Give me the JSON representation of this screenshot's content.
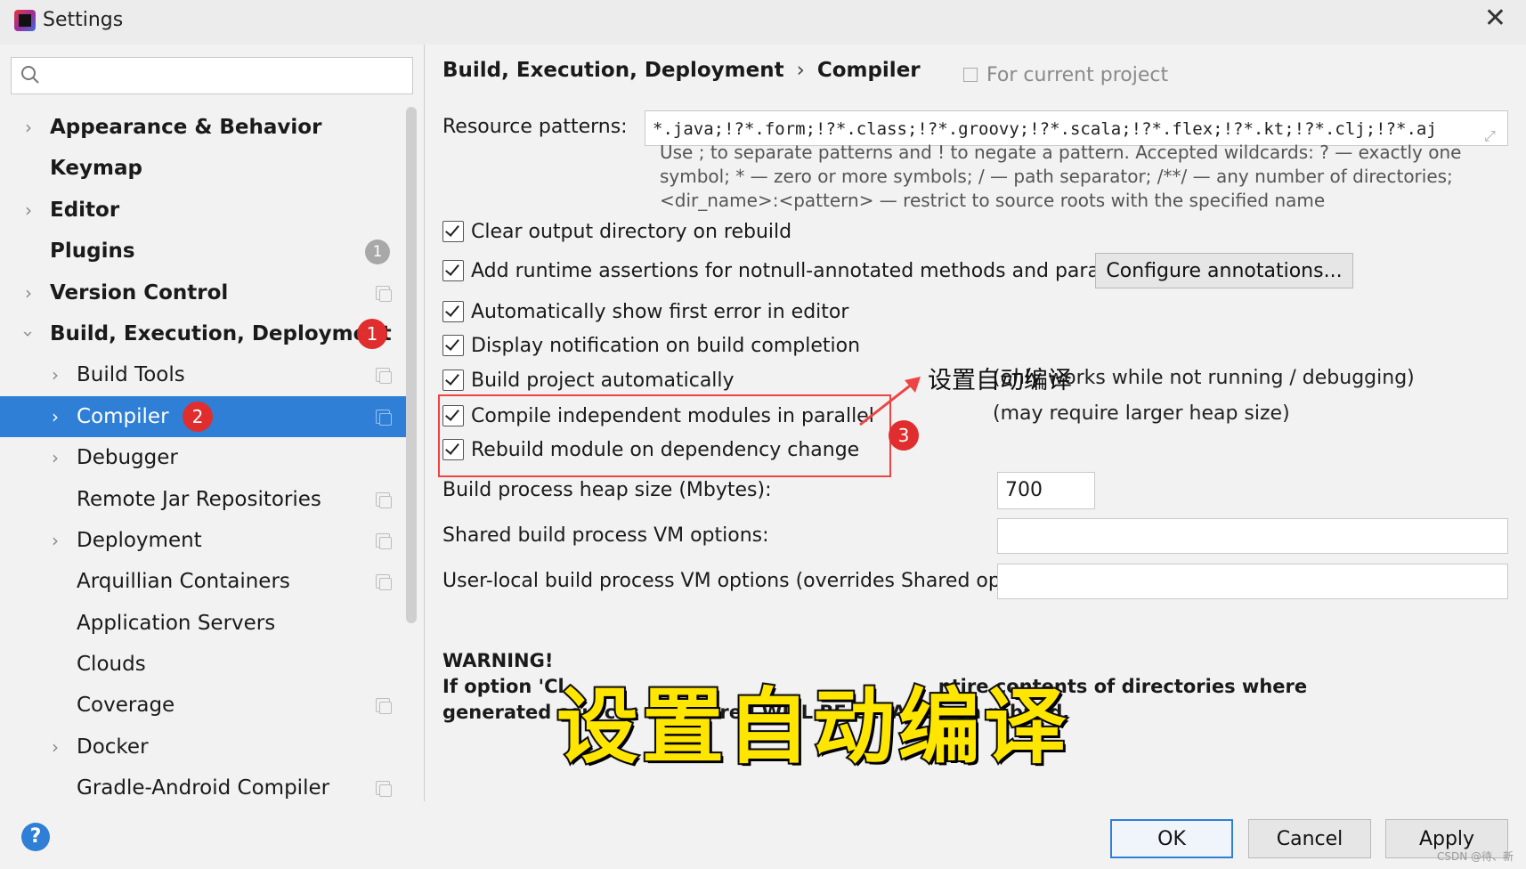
{
  "window": {
    "title": "Settings"
  },
  "sidebar": {
    "search_placeholder": "",
    "items": [
      {
        "label": "Appearance & Behavior",
        "level": 0,
        "expandable": true,
        "bold": true
      },
      {
        "label": "Keymap",
        "level": 0,
        "expandable": false,
        "bold": true
      },
      {
        "label": "Editor",
        "level": 0,
        "expandable": true,
        "bold": true
      },
      {
        "label": "Plugins",
        "level": 0,
        "expandable": false,
        "bold": true,
        "badge": "1"
      },
      {
        "label": "Version Control",
        "level": 0,
        "expandable": true,
        "bold": true,
        "project_icon": true
      },
      {
        "label": "Build, Execution, Deployment",
        "level": 0,
        "expandable": true,
        "expanded": true,
        "bold": true,
        "step": "1"
      },
      {
        "label": "Build Tools",
        "level": 1,
        "expandable": true,
        "project_icon": true
      },
      {
        "label": "Compiler",
        "level": 1,
        "expandable": true,
        "selected": true,
        "project_icon": true,
        "step": "2"
      },
      {
        "label": "Debugger",
        "level": 1,
        "expandable": true
      },
      {
        "label": "Remote Jar Repositories",
        "level": 1,
        "expandable": false,
        "project_icon": true
      },
      {
        "label": "Deployment",
        "level": 1,
        "expandable": true,
        "project_icon": true
      },
      {
        "label": "Arquillian Containers",
        "level": 1,
        "expandable": false,
        "project_icon": true
      },
      {
        "label": "Application Servers",
        "level": 1,
        "expandable": false
      },
      {
        "label": "Clouds",
        "level": 1,
        "expandable": false
      },
      {
        "label": "Coverage",
        "level": 1,
        "expandable": false,
        "project_icon": true
      },
      {
        "label": "Docker",
        "level": 1,
        "expandable": true
      },
      {
        "label": "Gradle-Android Compiler",
        "level": 1,
        "expandable": false,
        "project_icon": true
      }
    ]
  },
  "main": {
    "breadcrumb": {
      "parent": "Build, Execution, Deployment",
      "separator": "›",
      "current": "Compiler"
    },
    "scope_label": "For current project",
    "resource_patterns": {
      "label": "Resource patterns:",
      "value": "*.java;!?*.form;!?*.class;!?*.groovy;!?*.scala;!?*.flex;!?*.kt;!?*.clj;!?*.aj",
      "hint_line1": "Use ; to separate patterns and ! to negate a pattern. Accepted wildcards: ? — exactly one",
      "hint_line2": "symbol; * — zero or more symbols; / — path separator; /**/ — any number of directories;",
      "hint_line3": "<dir_name>:<pattern> — restrict to source roots with the specified name"
    },
    "checkboxes": {
      "clear_output": {
        "label": "Clear output directory on rebuild",
        "checked": true
      },
      "runtime_assertions": {
        "label": "Add runtime assertions for notnull-annotated methods and parameters",
        "checked": true
      },
      "show_first_error": {
        "label": "Automatically show first error in editor",
        "checked": true
      },
      "display_notification": {
        "label": "Display notification on build completion",
        "checked": true
      },
      "build_automatically": {
        "label": "Build project automatically",
        "checked": true,
        "note": "(only works while not running / debugging)"
      },
      "compile_parallel": {
        "label": "Compile independent modules in parallel",
        "checked": true,
        "note": "(may require larger heap size)"
      },
      "rebuild_on_dependency": {
        "label": "Rebuild module on dependency change",
        "checked": true
      }
    },
    "configure_annotations_label": "Configure annotations...",
    "heap_size": {
      "label": "Build process heap size (Mbytes):",
      "value": "700"
    },
    "shared_vm": {
      "label": "Shared build process VM options:",
      "value": ""
    },
    "user_vm": {
      "label": "User-local build process VM options (overrides Shared options):",
      "value": ""
    },
    "warning": {
      "heading": "WARNING!",
      "line1_start": "If option 'Cl",
      "line1_end": "ntire contents of directories where",
      "line2": "generated sources are stored WILL BE CLEARED on rebuild."
    }
  },
  "annotations": {
    "step3": "3",
    "note": "设置自动编译",
    "caption": "设置自动编译",
    "highlight_color": "#e44444",
    "caption_color": "#ffe600"
  },
  "footer": {
    "help_label": "?",
    "ok_label": "OK",
    "cancel_label": "Cancel",
    "apply_label": "Apply",
    "watermark": "CSDN @待、新"
  },
  "colors": {
    "selection": "#2f7fd6",
    "badge_red": "#e02d2d"
  }
}
